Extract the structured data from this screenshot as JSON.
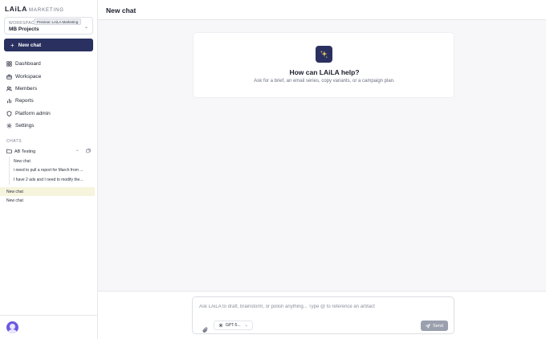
{
  "brand": {
    "name": "LAiLA",
    "product": "MARKETING"
  },
  "workspace": {
    "label": "WORKSPACE",
    "name": "MB Projects",
    "tooltip": "Preview: LAiLA Marketing"
  },
  "new_chat_button": "New chat",
  "nav": {
    "items": [
      {
        "label": "Dashboard",
        "icon": "dashboard-icon"
      },
      {
        "label": "Workspace",
        "icon": "briefcase-icon"
      },
      {
        "label": "Members",
        "icon": "users-icon"
      },
      {
        "label": "Reports",
        "icon": "chart-icon"
      },
      {
        "label": "Platform admin",
        "icon": "shield-icon"
      },
      {
        "label": "Settings",
        "icon": "gear-icon"
      }
    ]
  },
  "chats": {
    "label": "CHATS",
    "folder": {
      "name": "AB Testing",
      "children": [
        "New chat",
        "i need to pull a report for March from ...",
        "I have 2 ads and I need to modify the..."
      ]
    },
    "items": [
      {
        "title": "New chat",
        "active": true
      },
      {
        "title": "New chat",
        "active": false
      }
    ]
  },
  "header": {
    "title": "New chat"
  },
  "welcome": {
    "title": "How can LAiLA help?",
    "subtitle": "Ask for a brief, an email series, copy variants, or a campaign plan."
  },
  "composer": {
    "placeholder": "Ask LAiLA to draft, brainstorm, or polish anything... Type @ to reference an artifact",
    "value": "",
    "model": "GPT-5...",
    "send_label": "Send"
  },
  "colors": {
    "accent": "#2a3160",
    "active_chat_bg": "#f6f4dc",
    "send_disabled": "#9aa0ad",
    "avatar": "#6b5be0"
  }
}
